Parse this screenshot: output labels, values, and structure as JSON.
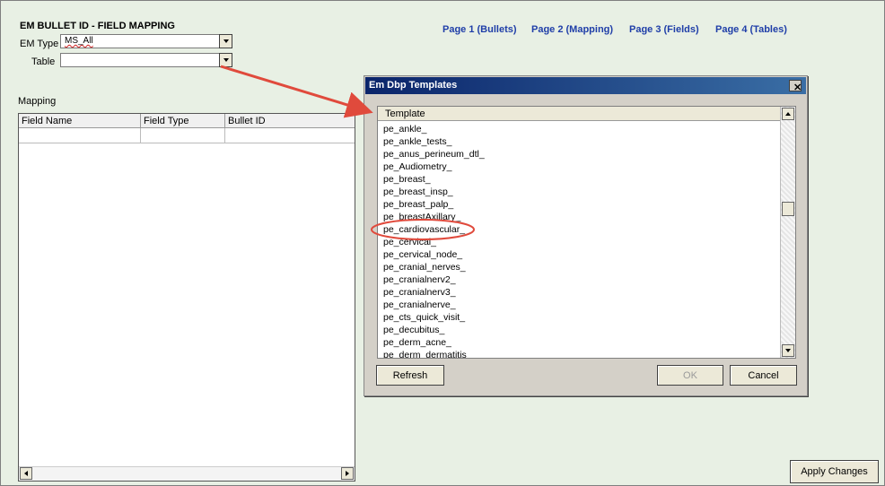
{
  "page": {
    "title": "EM BULLET ID - FIELD MAPPING",
    "em_type_label": "EM Type",
    "em_type_value": "MS_All",
    "table_label": "Table",
    "table_value": "",
    "mapping_label": "Mapping"
  },
  "nav": {
    "links": [
      "Page 1 (Bullets)",
      "Page 2 (Mapping)",
      "Page 3 (Fields)",
      "Page 4 (Tables)"
    ]
  },
  "grid": {
    "columns": [
      "Field Name",
      "Field Type",
      "Bullet ID"
    ]
  },
  "dialog": {
    "title": "Em Dbp Templates",
    "column_header": "Template",
    "items": [
      "pe_ankle_",
      "pe_ankle_tests_",
      "pe_anus_perineum_dtl_",
      "pe_Audiometry_",
      "pe_breast_",
      "pe_breast_insp_",
      "pe_breast_palp_",
      "pe_breastAxillary_",
      "pe_cardiovascular_",
      "pe_cervical_",
      "pe_cervical_node_",
      "pe_cranial_nerves_",
      "pe_cranialnerv2_",
      "pe_cranialnerv3_",
      "pe_cranialnerve_",
      "pe_cts_quick_visit_",
      "pe_decubitus_",
      "pe_derm_acne_",
      "pe_derm_dermatitis"
    ],
    "refresh_label": "Refresh",
    "ok_label": "OK",
    "cancel_label": "Cancel"
  },
  "footer": {
    "apply_label": "Apply Changes"
  },
  "annotation": {
    "color": "#e04a3c"
  }
}
